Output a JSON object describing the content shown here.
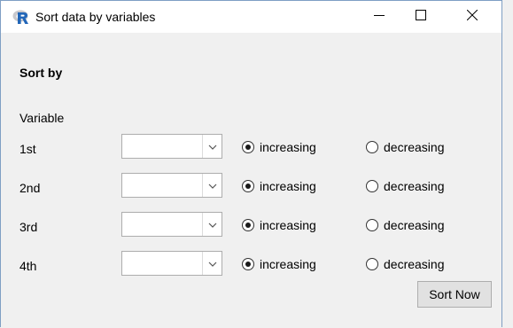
{
  "window": {
    "title": "Sort data by variables",
    "app_icon": "r-logo-icon",
    "controls": {
      "minimize": "minimize-icon",
      "maximize": "maximize-icon",
      "close": "close-icon"
    }
  },
  "form": {
    "section_label": "Sort by",
    "variable_header": "Variable",
    "rows": [
      {
        "label": "1st",
        "selected_value": "",
        "increasing_label": "increasing",
        "decreasing_label": "decreasing",
        "order": "increasing"
      },
      {
        "label": "2nd",
        "selected_value": "",
        "increasing_label": "increasing",
        "decreasing_label": "decreasing",
        "order": "increasing"
      },
      {
        "label": "3rd",
        "selected_value": "",
        "increasing_label": "increasing",
        "decreasing_label": "decreasing",
        "order": "increasing"
      },
      {
        "label": "4th",
        "selected_value": "",
        "increasing_label": "increasing",
        "decreasing_label": "decreasing",
        "order": "increasing"
      }
    ],
    "sort_button_label": "Sort Now"
  },
  "colors": {
    "window_bg": "#f0f0f0",
    "titlebar_bg": "#ffffff",
    "r_logo_blue": "#2266b8",
    "button_bg": "#e1e1e1",
    "border": "#adadad"
  }
}
